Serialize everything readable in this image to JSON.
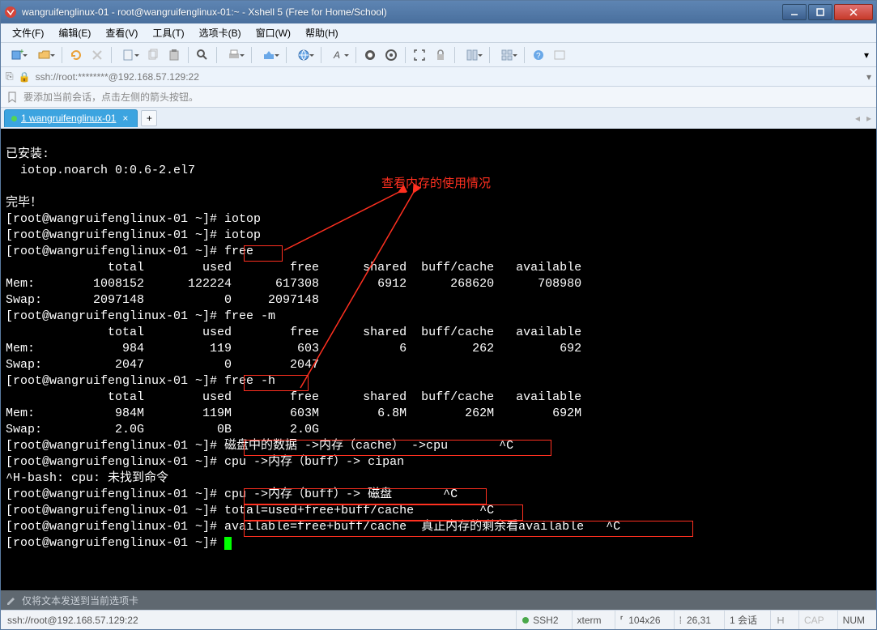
{
  "window": {
    "title": "wangruifenglinux-01 - root@wangruifenglinux-01:~ - Xshell 5 (Free for Home/School)"
  },
  "menus": {
    "file": "文件(F)",
    "edit": "编辑(E)",
    "view": "查看(V)",
    "tools": "工具(T)",
    "tabs": "选项卡(B)",
    "window": "窗口(W)",
    "help": "帮助(H)"
  },
  "address": {
    "text": "ssh://root:********@192.168.57.129:22"
  },
  "infobar": {
    "text": "要添加当前会话，点击左侧的箭头按钮。"
  },
  "tab": {
    "label": "1 wangruifenglinux-01"
  },
  "annotation": {
    "title": "查看内存的使用情况"
  },
  "terminal": {
    "lines": [
      "",
      "已安装:",
      "  iotop.noarch 0:0.6-2.el7",
      "",
      "完毕！",
      "[root@wangruifenglinux-01 ~]# iotop",
      "[root@wangruifenglinux-01 ~]# iotop",
      "[root@wangruifenglinux-01 ~]# free",
      "              total        used        free      shared  buff/cache   available",
      "Mem:        1008152      122224      617308        6912      268620      708980",
      "Swap:       2097148           0     2097148",
      "[root@wangruifenglinux-01 ~]# free -m",
      "              total        used        free      shared  buff/cache   available",
      "Mem:            984         119         603           6         262         692",
      "Swap:          2047           0        2047",
      "[root@wangruifenglinux-01 ~]# free -h",
      "              total        used        free      shared  buff/cache   available",
      "Mem:           984M        119M        603M        6.8M        262M        692M",
      "Swap:          2.0G          0B        2.0G",
      "[root@wangruifenglinux-01 ~]# 磁盘中的数据 ->内存（cache） ->cpu       ^C",
      "[root@wangruifenglinux-01 ~]# cpu ->内存（buff）-> cipan",
      "^H-bash: cpu: 未找到命令",
      "[root@wangruifenglinux-01 ~]# cpu ->内存（buff）-> 磁盘       ^C",
      "[root@wangruifenglinux-01 ~]# total=used+free+buff/cache         ^C",
      "[root@wangruifenglinux-01 ~]# available=free+buff/cache  真正内存的剩余看available   ^C",
      "[root@wangruifenglinux-01 ~]# "
    ]
  },
  "bottom_note": {
    "text": "仅将文本发送到当前选项卡"
  },
  "status": {
    "left": "ssh://root@192.168.57.129:22",
    "ssh": "SSH2",
    "term": "xterm",
    "size": "104x26",
    "cursor_lbl": "26,31",
    "sessions": "1 会话",
    "cap": "CAP",
    "num": "NUM"
  }
}
